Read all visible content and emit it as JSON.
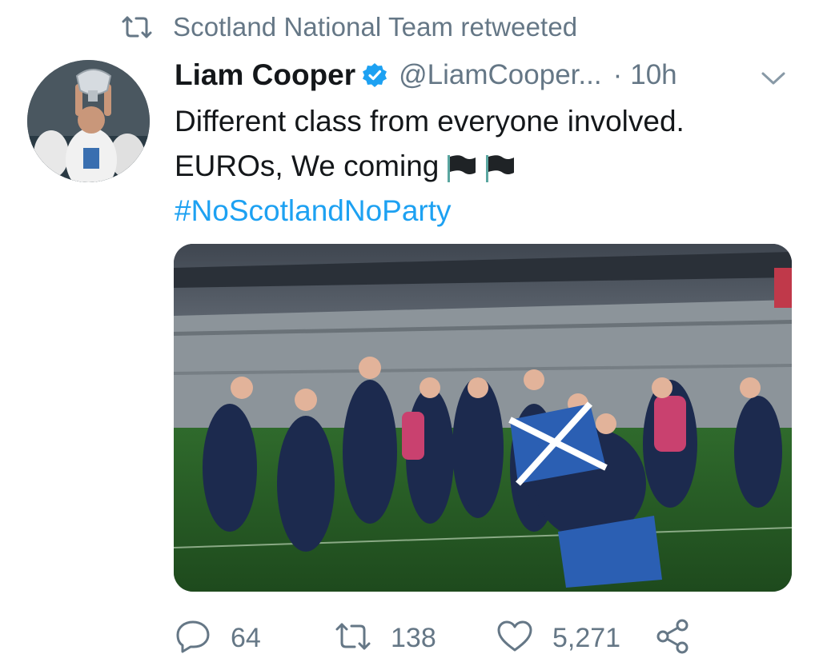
{
  "context": {
    "retweet_label": "Scotland National Team retweeted",
    "icon": "retweet-icon"
  },
  "author": {
    "display_name": "Liam Cooper",
    "handle": "@LiamCooper...",
    "separator": "·",
    "timestamp": "10h",
    "verified": true
  },
  "tweet": {
    "line1": "Different class from everyone involved.",
    "line2": "EUROs, We coming",
    "hashtag": "#NoScotlandNoParty",
    "emoji": [
      "black-flag",
      "black-flag"
    ]
  },
  "media": {
    "description": "Scotland team celebrating on pitch",
    "icon": "photo"
  },
  "actions": {
    "reply_count": "64",
    "retweet_count": "138",
    "like_count": "5,271"
  },
  "colors": {
    "accent": "#1da1f2",
    "secondary_text": "#657786",
    "primary_text": "#14171a"
  }
}
